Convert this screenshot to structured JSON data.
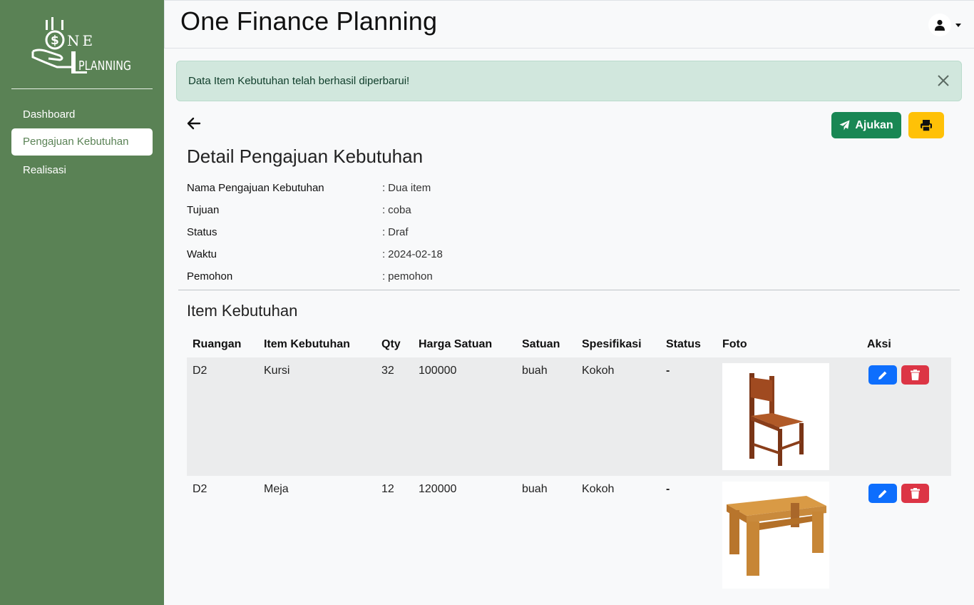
{
  "sidebar": {
    "logo_text_top": "NE",
    "logo_text_bottom": "PLANNING",
    "items": [
      {
        "label": "Dashboard"
      },
      {
        "label": "Pengajuan Kebutuhan"
      },
      {
        "label": "Realisasi"
      }
    ],
    "active_item": "Pengajuan Kebutuhan"
  },
  "header": {
    "title": "One Finance Planning",
    "user_icon": "user-icon"
  },
  "alert": {
    "message": "Data Item Kebutuhan telah berhasil diperbarui!"
  },
  "actions": {
    "submit_label": "Ajukan",
    "submit_icon": "paper-plane-icon",
    "print_icon": "printer-icon",
    "back_icon": "arrow-left-icon"
  },
  "detail": {
    "heading": "Detail Pengajuan Kebutuhan",
    "rows": [
      {
        "label": "Nama Pengajuan Kebutuhan",
        "value": "Dua item"
      },
      {
        "label": "Tujuan",
        "value": "coba"
      },
      {
        "label": "Status",
        "value": "Draf"
      },
      {
        "label": "Waktu",
        "value": "2024-02-18"
      },
      {
        "label": "Pemohon",
        "value": "pemohon"
      }
    ]
  },
  "items_section": {
    "heading": "Item Kebutuhan",
    "columns": [
      "Ruangan",
      "Item Kebutuhan",
      "Qty",
      "Harga Satuan",
      "Satuan",
      "Spesifikasi",
      "Status",
      "Foto",
      "Aksi"
    ],
    "rows": [
      {
        "ruangan": "D2",
        "item": "Kursi",
        "qty": "32",
        "harga": "100000",
        "satuan": "buah",
        "spesifikasi": "Kokoh",
        "status": "-",
        "photo": "chair"
      },
      {
        "ruangan": "D2",
        "item": "Meja",
        "qty": "12",
        "harga": "120000",
        "satuan": "buah",
        "spesifikasi": "Kokoh",
        "status": "-",
        "photo": "table"
      }
    ]
  },
  "colors": {
    "sidebar": "#5a8255",
    "success": "#198754",
    "warning": "#ffc107",
    "primary": "#0d6efd",
    "danger": "#dc3545",
    "alert_bg": "#d1e7dd"
  }
}
